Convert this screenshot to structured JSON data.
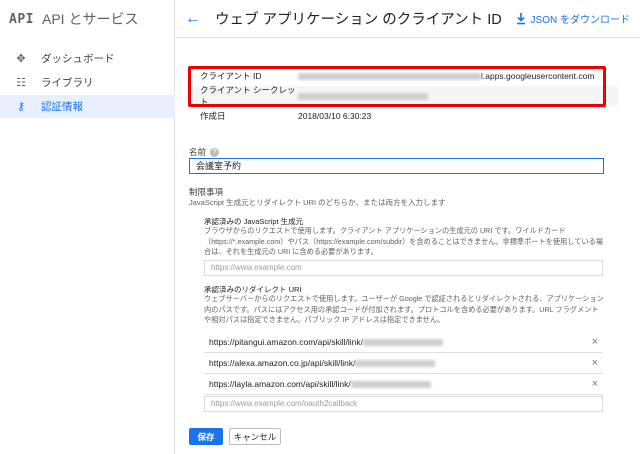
{
  "brand": {
    "logo": "API",
    "title": "API とサービス"
  },
  "sidebar": {
    "items": [
      {
        "label": "ダッシュボード",
        "icon": "diamond-grid-icon",
        "glyph": "✥",
        "active": false
      },
      {
        "label": "ライブラリ",
        "icon": "library-icon",
        "glyph": "☷",
        "active": false
      },
      {
        "label": "認証情報",
        "icon": "key-icon",
        "glyph": "⚷",
        "active": true
      }
    ]
  },
  "header": {
    "back_glyph": "←",
    "title": "ウェブ アプリケーション のクライアント ID",
    "download_label": "JSON をダウンロード"
  },
  "client_info": {
    "client_id_label": "クライアント ID",
    "client_id_suffix": "l.apps.googleusercontent.com",
    "client_secret_label": "クライアント シークレット",
    "created_label": "作成日",
    "created_value": "2018/03/10 6:30:23"
  },
  "form": {
    "name_label": "名前",
    "name_help": "?",
    "name_value": "会議室予約",
    "restrictions_title": "制限事項",
    "restrictions_desc": "JavaScript 生成元とリダイレクト URI のどちらか、または両方を入力します",
    "js_origins_title": "承認済みの JavaScript 生成元",
    "js_origins_desc": "ブラウザからのリクエストで使用します。クライアント アプリケーションの生成元の URI です。ワイルドカード（https://*.example.com）やパス（https://example.com/subdir）を含めることはできません。非標準ポートを使用している場合は、それを生成元の URI に含める必要があります。",
    "js_origins_placeholder": "https://www.example.com",
    "redirect_title": "承認済みのリダイレクト URI",
    "redirect_desc": "ウェブサーバーからのリクエストで使用します。ユーザーが Google で認証されるとリダイレクトされる、アプリケーション内のパスです。パスにはアクセス用の承認コードが付加されます。プロトコルを含める必要があります。URL フラグメントや相対パスは指定できません。パブリック IP アドレスは指定できません。",
    "redirect_uris": [
      "https://pitangui.amazon.com/api/skill/link/",
      "https://alexa.amazon.co.jp/api/skill/link/",
      "https://layla.amazon.com/api/skill/link/"
    ],
    "remove_glyph": "×",
    "redirect_placeholder": "https://www.example.com/oauth2callback"
  },
  "actions": {
    "save": "保存",
    "cancel": "キャンセル"
  },
  "colors": {
    "accent": "#1a73e8",
    "highlight": "#ee0000"
  }
}
